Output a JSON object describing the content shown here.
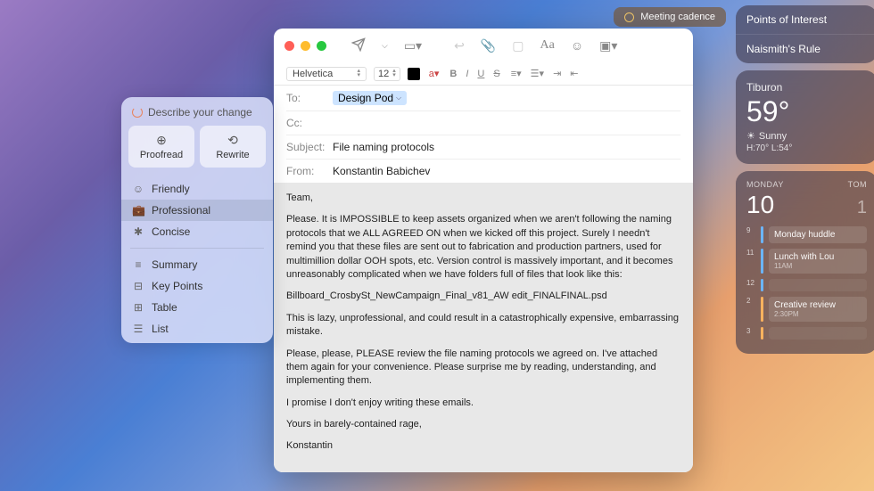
{
  "reminder": {
    "label": "Meeting cadence"
  },
  "sidebar_list": {
    "items": [
      "Points of Interest",
      "Naismith's Rule"
    ]
  },
  "weather": {
    "location": "Tiburon",
    "temp": "59°",
    "condition": "Sunny",
    "range": "H:70° L:54°"
  },
  "calendar": {
    "day_label": "MONDAY",
    "next_label": "TOM",
    "date": "10",
    "next_date": "1",
    "events": [
      {
        "time": "9",
        "title": "Monday huddle",
        "color": "blue"
      },
      {
        "time": "11",
        "title": "Lunch with Lou",
        "sub": "11AM",
        "color": "blue"
      },
      {
        "time": "12",
        "title": "",
        "color": "blue",
        "empty": true
      },
      {
        "time": "2",
        "title": "Creative review",
        "sub": "2:30PM",
        "color": "orange"
      },
      {
        "time": "3",
        "title": "",
        "color": "orange",
        "empty": true
      }
    ]
  },
  "writing_tools": {
    "header": "Describe your change",
    "proofread": "Proofread",
    "rewrite": "Rewrite",
    "tones": [
      {
        "icon": "☺",
        "label": "Friendly"
      },
      {
        "icon": "💼",
        "label": "Professional",
        "selected": true
      },
      {
        "icon": "✱",
        "label": "Concise"
      }
    ],
    "formats": [
      {
        "icon": "≡",
        "label": "Summary"
      },
      {
        "icon": "⊟",
        "label": "Key Points"
      },
      {
        "icon": "⊞",
        "label": "Table"
      },
      {
        "icon": "☰",
        "label": "List"
      }
    ]
  },
  "mail": {
    "format": {
      "font": "Helvetica",
      "size": "12"
    },
    "headers": {
      "to_label": "To:",
      "to_value": "Design Pod",
      "cc_label": "Cc:",
      "subject_label": "Subject:",
      "subject_value": "File naming protocols",
      "from_label": "From:",
      "from_value": "Konstantin Babichev"
    },
    "body": {
      "p1": "Team,",
      "p2": "Please. It is IMPOSSIBLE to keep assets organized when we aren't following the naming protocols that we ALL AGREED ON when we kicked off this project. Surely I needn't remind you that these files are sent out to fabrication and production partners, used for multimillion dollar OOH spots, etc. Version control is massively important, and it becomes unreasonably complicated when we have folders full of files that look like this:",
      "p3": "Billboard_CrosbySt_NewCampaign_Final_v81_AW edit_FINALFINAL.psd",
      "p4": "This is lazy, unprofessional, and could result in a catastrophically expensive, embarrassing mistake.",
      "p5": "Please, please, PLEASE review the file naming protocols we agreed on. I've attached them again for your convenience. Please surprise me by reading, understanding, and implementing them.",
      "p6": "I promise I don't enjoy writing these emails.",
      "p7": "Yours in barely-contained rage,",
      "p8": "Konstantin"
    }
  }
}
